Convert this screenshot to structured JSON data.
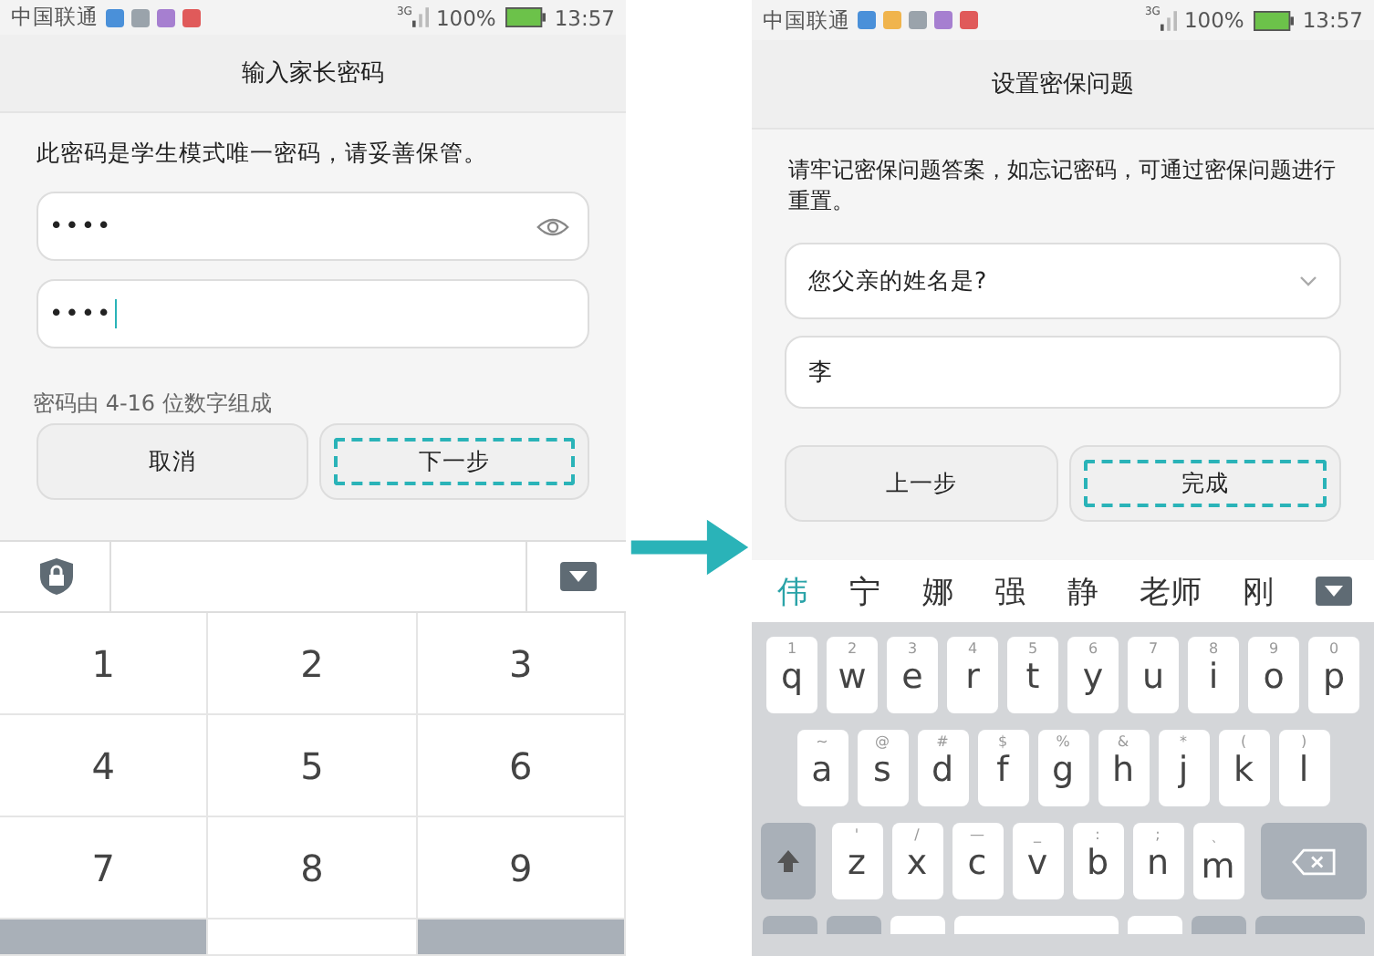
{
  "password_screen": {
    "status_bar": {
      "carrier": "中国联通",
      "network": "3G",
      "battery": "100%",
      "time": "13:57"
    },
    "title": "输入家长密码",
    "description": "此密码是学生模式唯一密码，请妥善保管。",
    "fields": [
      {
        "value": "••••",
        "focused": false,
        "reveal_icon": true
      },
      {
        "value": "••••",
        "focused": true,
        "reveal_icon": false
      }
    ],
    "hint": "密码由 4-16 位数字组成",
    "buttons": [
      {
        "label": "取消",
        "highlighted": false
      },
      {
        "label": "下一步",
        "highlighted": true
      }
    ],
    "keypad": [
      "1",
      "2",
      "3",
      "4",
      "5",
      "6",
      "7",
      "8",
      "9"
    ]
  },
  "security_question_screen": {
    "status_bar": {
      "carrier": "中国联通",
      "network": "3G",
      "battery": "100%",
      "time": "13:57"
    },
    "title": "设置密保问题",
    "description": "请牢记密保问题答案，如忘记密码，可通过密保问题进行重置。",
    "question": "您父亲的姓名是?",
    "answer": "李",
    "buttons": [
      {
        "label": "上一步",
        "highlighted": false
      },
      {
        "label": "完成",
        "highlighted": true
      }
    ],
    "candidates": [
      {
        "text": "伟",
        "selected": true
      },
      {
        "text": "宁",
        "selected": false
      },
      {
        "text": "娜",
        "selected": false
      },
      {
        "text": "强",
        "selected": false
      },
      {
        "text": "静",
        "selected": false
      },
      {
        "text": "老师",
        "selected": false
      },
      {
        "text": "刚",
        "selected": false
      }
    ],
    "keyboard_rows": [
      [
        {
          "letter": "q",
          "hint": "1"
        },
        {
          "letter": "w",
          "hint": "2"
        },
        {
          "letter": "e",
          "hint": "3"
        },
        {
          "letter": "r",
          "hint": "4"
        },
        {
          "letter": "t",
          "hint": "5"
        },
        {
          "letter": "y",
          "hint": "6"
        },
        {
          "letter": "u",
          "hint": "7"
        },
        {
          "letter": "i",
          "hint": "8"
        },
        {
          "letter": "o",
          "hint": "9"
        },
        {
          "letter": "p",
          "hint": "0"
        }
      ],
      [
        {
          "letter": "a",
          "hint": "~"
        },
        {
          "letter": "s",
          "hint": "@"
        },
        {
          "letter": "d",
          "hint": "#"
        },
        {
          "letter": "f",
          "hint": "$"
        },
        {
          "letter": "g",
          "hint": "%"
        },
        {
          "letter": "h",
          "hint": "&"
        },
        {
          "letter": "j",
          "hint": "*"
        },
        {
          "letter": "k",
          "hint": "("
        },
        {
          "letter": "l",
          "hint": ")"
        }
      ],
      [
        {
          "letter": "z",
          "hint": "'"
        },
        {
          "letter": "x",
          "hint": "/"
        },
        {
          "letter": "c",
          "hint": "—"
        },
        {
          "letter": "v",
          "hint": "_"
        },
        {
          "letter": "b",
          "hint": ":"
        },
        {
          "letter": "n",
          "hint": ";"
        },
        {
          "letter": "m",
          "hint": "、"
        }
      ]
    ]
  }
}
